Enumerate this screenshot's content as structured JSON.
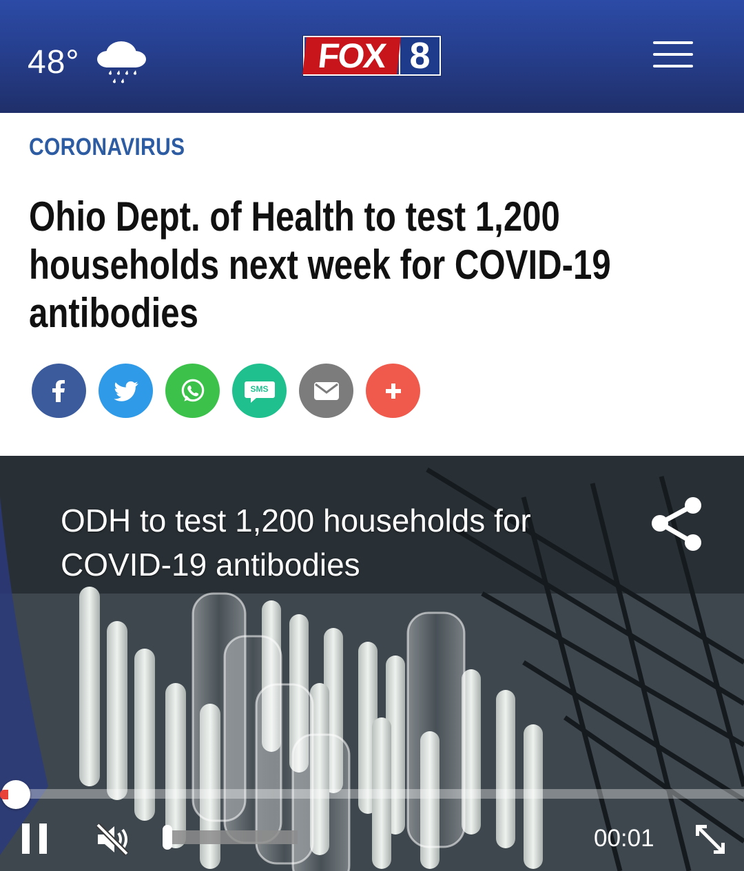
{
  "header": {
    "temperature": "48°",
    "weather_icon": "rain-cloud-icon",
    "logo": {
      "word": "FOX",
      "number": "8"
    },
    "menu_icon": "hamburger-menu-icon"
  },
  "article": {
    "category": "CORONAVIRUS",
    "headline_lines": [
      "Ohio Dept. of Health to test 1,200",
      "households next week for COVID-19",
      "antibodies"
    ],
    "share_buttons": [
      {
        "icon": "facebook-icon",
        "color": "#3b5b9d"
      },
      {
        "icon": "twitter-icon",
        "color": "#2f9ae8"
      },
      {
        "icon": "whatsapp-icon",
        "color": "#3cc24b"
      },
      {
        "icon": "sms-icon",
        "label": "SMS",
        "color": "#1fc08e"
      },
      {
        "icon": "email-icon",
        "color": "#7c7c7c"
      },
      {
        "icon": "more-plus-icon",
        "color": "#ef5a4c"
      }
    ]
  },
  "video": {
    "title_lines": [
      "ODH to test 1,200 households for",
      "COVID-19 antibodies"
    ],
    "current_time": "00:01",
    "muted": true,
    "playing": true,
    "progress_fraction": 0.0
  },
  "colors": {
    "header_blue": "#263f8e",
    "category_blue": "#2d5ca3",
    "logo_red": "#c7151b"
  }
}
